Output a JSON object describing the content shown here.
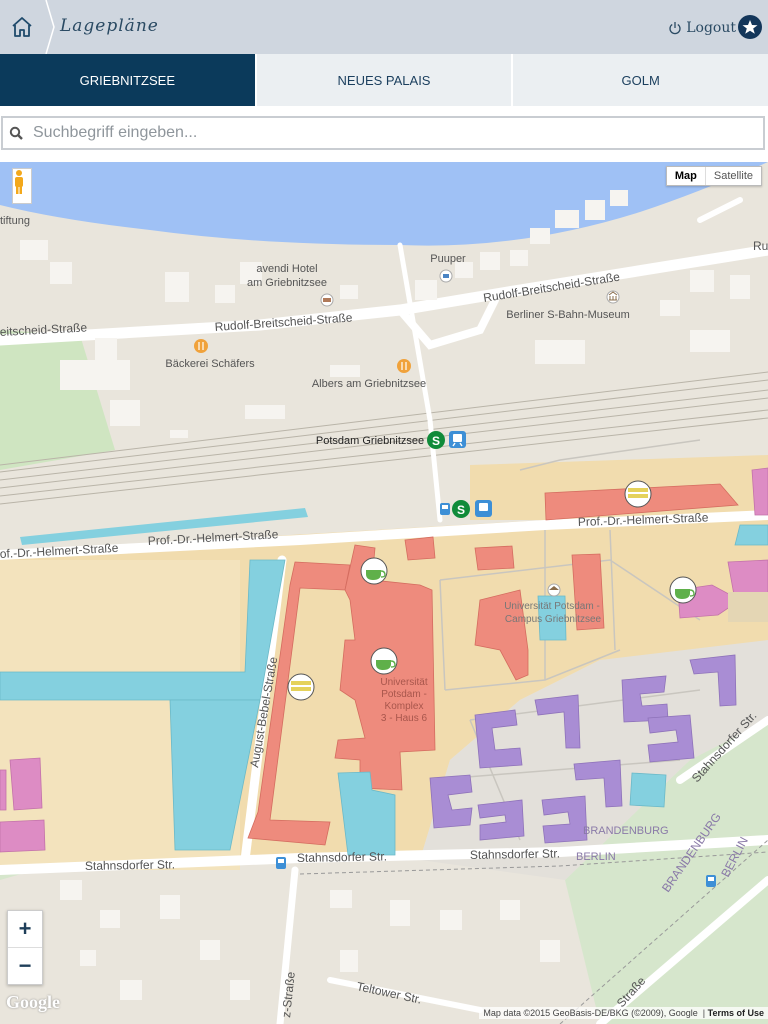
{
  "header": {
    "title": "Lagepläne",
    "logout_label": "Logout",
    "icons": {
      "home": "home-icon",
      "power": "power-icon",
      "star": "star-icon"
    }
  },
  "tabs": [
    {
      "label": "GRIEBNITZSEE",
      "active": true
    },
    {
      "label": "NEUES PALAIS",
      "active": false
    },
    {
      "label": "GOLM",
      "active": false
    }
  ],
  "search": {
    "placeholder": "Suchbegriff eingeben...",
    "value": ""
  },
  "map": {
    "map_type": {
      "map_label": "Map",
      "satellite_label": "Satellite",
      "selected": "Map"
    },
    "zoom": {
      "in": "+",
      "out": "−"
    },
    "logo": "Google",
    "attribution": "Map data ©2015 GeoBasis-DE/BKG (©2009), Google",
    "terms": "Terms of Use",
    "labels": {
      "stiftung": "tiftung",
      "avendi1": "avendi Hotel",
      "avendi2": "am Griebnitzsee",
      "puuper": "Puuper",
      "rbs_right": "Rudolf-Breitscheid-Straße",
      "rbs_mid": "Rudolf-Breitscheid-Straße",
      "rbs_left": "eitscheid-Straße",
      "sbahn_museum": "Berliner S-Bahn-Museum",
      "baeckerei": "Bäckerei Schäfers",
      "albers": "Albers am Griebnitzsee",
      "station": "Potsdam Griebnitzsee",
      "helmert_left": "of.-Dr.-Helmert-Straße",
      "helmert_mid": "Prof.-Dr.-Helmert-Straße",
      "helmert_right": "Prof.-Dr.-Helmert-Straße",
      "campus1": "Universität Potsdam -",
      "campus2": "Campus Griebnitzsee",
      "komplex1": "Universität",
      "komplex2": "Potsdam -",
      "komplex3": "Komplex",
      "komplex4": "3 - Haus 6",
      "bebel": "August-Bebel-Straße",
      "stahnsdorfer_left": "Stahnsdorfer Str.",
      "stahnsdorfer_mid": "Stahnsdorfer Str.",
      "stahnsdorfer_right": "Stahnsdorfer Str.",
      "stahnsdorfer_diag": "Stahnsdorfer Str.",
      "brandenburg": "BRANDENBURG",
      "berlin": "BERLIN",
      "brandenburg_diag": "BRANDENBURG",
      "berlin_diag": "BERLIN",
      "teltower": "Teltower Str.",
      "strasse": "Straße",
      "rud_top": "Ru",
      "z_strasse": "z-Straße"
    }
  },
  "colors": {
    "header_bg": "#cfd6df",
    "tab_active": "#0b3a5b",
    "water": "#9fc1f5",
    "land": "#e9e5dc",
    "campus": "#f1dcae",
    "building_red": "#ee8b7d",
    "building_blue": "#84d0df",
    "building_purple": "#a98dd4",
    "building_pink": "#dd8cc4",
    "park": "#cfe5c1"
  }
}
